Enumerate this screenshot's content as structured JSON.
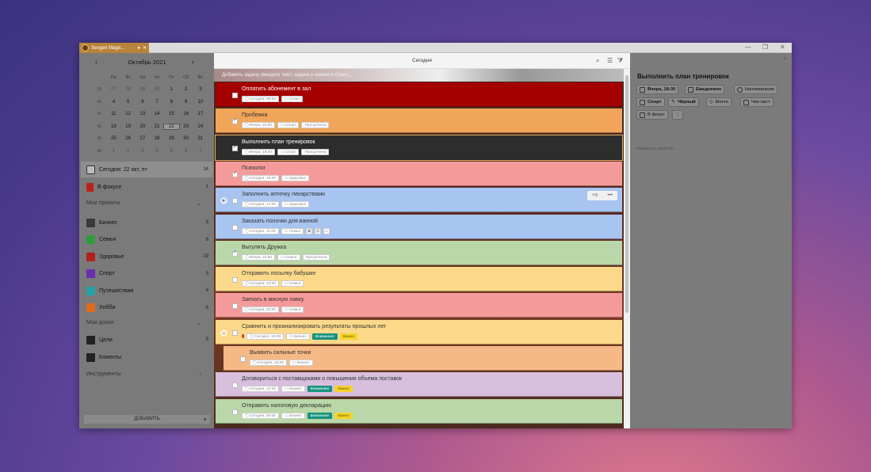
{
  "window": {
    "app_title": "Sevgeri Magic...",
    "controls": [
      "—",
      "❐",
      "✕"
    ]
  },
  "calendar": {
    "month": "Октябрь 2021",
    "dow": [
      "Пн",
      "Вт",
      "Ср",
      "Чт",
      "Пт",
      "Сб",
      "Вс"
    ],
    "weeks": [
      {
        "wk": "39",
        "days": [
          "27",
          "28",
          "29",
          "30",
          "1",
          "2",
          "3"
        ]
      },
      {
        "wk": "40",
        "days": [
          "4",
          "5",
          "6",
          "7",
          "8",
          "9",
          "10"
        ]
      },
      {
        "wk": "41",
        "days": [
          "11",
          "12",
          "13",
          "14",
          "15",
          "16",
          "17"
        ]
      },
      {
        "wk": "42",
        "days": [
          "18",
          "19",
          "20",
          "21",
          "22",
          "23",
          "24"
        ]
      },
      {
        "wk": "43",
        "days": [
          "25",
          "26",
          "27",
          "28",
          "29",
          "30",
          "31"
        ]
      },
      {
        "wk": "44",
        "days": [
          "1",
          "2",
          "3",
          "4",
          "5",
          "6",
          "7"
        ]
      }
    ]
  },
  "sidebar": {
    "today": {
      "label": "Сегодня: 22 окт, пт",
      "count": "14"
    },
    "focus": {
      "label": "В фокусе",
      "count": "1"
    },
    "projects_title": "Мои проекты",
    "projects": [
      {
        "label": "Бизнес",
        "count": "8",
        "color": "#3a3a3a"
      },
      {
        "label": "Семья",
        "count": "6",
        "color": "#2f9e3a"
      },
      {
        "label": "Здоровье",
        "count": "19",
        "color": "#b0201c"
      },
      {
        "label": "Спорт",
        "count": "5",
        "color": "#6a2fb0"
      },
      {
        "label": "Путешествия",
        "count": "6",
        "color": "#23a3a3"
      },
      {
        "label": "Хобби",
        "count": "8",
        "color": "#e06a1a"
      }
    ],
    "boards_title": "Мои доски",
    "boards": [
      {
        "label": "Цели",
        "count": "9"
      },
      {
        "label": "Клиенты",
        "count": ""
      }
    ],
    "tools_title": "Инструменты",
    "add_label": "ДОБАВИТЬ",
    "add_plus": "+"
  },
  "main": {
    "title": "Сегодня",
    "add_placeholder": "Добавить задачу (введите текст задачи и нажмите Enter)...",
    "tasks": [
      {
        "title": "Оплатить абонемент в зал",
        "date": "Сегодня, 08:00",
        "project": "Спорт",
        "extra": []
      },
      {
        "title": "Пробежка",
        "date": "Вчера, 21:00",
        "project": "Спорт",
        "extra": [
          "Просрочена"
        ]
      },
      {
        "title": "Выполнить план тренировок",
        "date": "Вчера, 18:30",
        "project": "Спорт",
        "extra": [
          "Просрочена"
        ]
      },
      {
        "title": "Психолог",
        "date": "Сегодня, 19:00",
        "project": "Здоровье",
        "extra": []
      },
      {
        "title": "Заполнить аптечку лекарствами",
        "date": "Сегодня, 17:00",
        "project": "Здоровье",
        "extra": []
      },
      {
        "title": "Заказать полочки для ванной",
        "date": "Сегодня, 11:00",
        "project": "Семья",
        "extra": []
      },
      {
        "title": "Выгулять Дружка",
        "date": "Вчера, 22:00",
        "project": "Семья",
        "extra": [
          "Просрочена"
        ]
      },
      {
        "title": "Отправить посылку бабушке",
        "date": "Сегодня, 13:00",
        "project": "Семья",
        "extra": []
      },
      {
        "title": "Заехать в мясную лавку",
        "date": "Сегодня, 20:00",
        "project": "Семья",
        "extra": []
      },
      {
        "title": "Сравнить и проанализировать результаты прошлых лет",
        "date": "Сегодня, 15:00",
        "project": "Бизнес",
        "extra": [
          "Внимание!",
          "Важно"
        ]
      },
      {
        "title": "Выявить сильные точки",
        "date": "Сегодня, 15:00",
        "project": "Бизнес",
        "extra": []
      },
      {
        "title": "Договориться с поставщиками о повышении объема поставок",
        "date": "Сегодня, 10:00",
        "project": "Бизнес",
        "extra": [
          "Внимание!",
          "Важно"
        ]
      },
      {
        "title": "Отправить налоговую декларацию",
        "date": "Сегодня, 09:00",
        "project": "Бизнес",
        "extra": [
          "Внимание!",
          "Важно"
        ]
      }
    ],
    "row_actions": "•••"
  },
  "detail": {
    "title": "Выполнить план тренировок",
    "date_btn": "Вчера, 18:30",
    "repeat_btn": "Ежедневно",
    "reminder_btn": "Напоминание",
    "project_btn": "Спорт",
    "color_btn": "Чёрный",
    "tags_btn": "Метки",
    "checklist_btn": "Чек-лист",
    "focus_btn": "В фокус",
    "more_btn": "⋮",
    "notes_placeholder": "Напишите заметку...",
    "close": "×"
  }
}
